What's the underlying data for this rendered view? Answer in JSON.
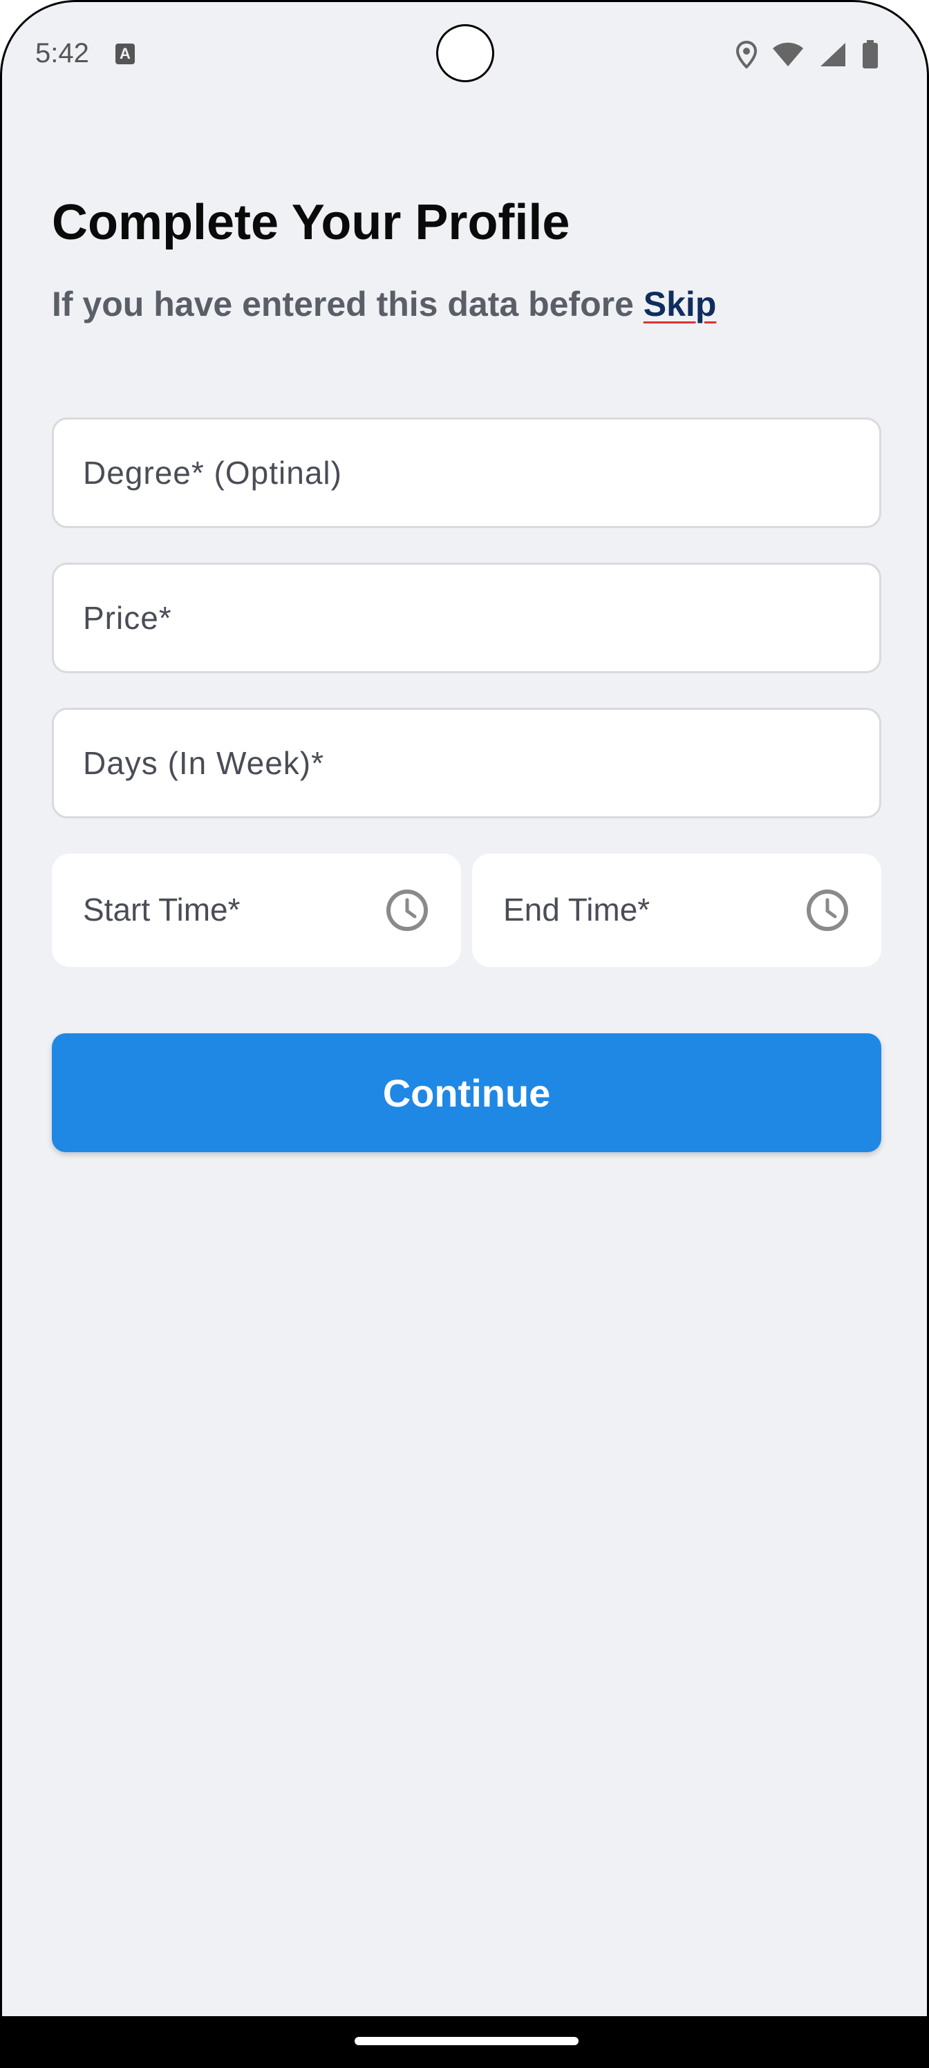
{
  "status_bar": {
    "time": "5:42",
    "keyboard_icon_letter": "A",
    "icons": [
      "location-icon",
      "wifi-icon",
      "signal-icon",
      "battery-icon"
    ]
  },
  "header": {
    "title": "Complete Your Profile",
    "subtitle_text": "If you have entered this data before ",
    "skip_label": "Skip"
  },
  "form": {
    "degree": {
      "placeholder": "Degree* (Optinal)",
      "value": ""
    },
    "price": {
      "placeholder": "Price*",
      "value": ""
    },
    "days": {
      "placeholder": "Days (In Week)*",
      "value": ""
    },
    "start_time": {
      "label": "Start Time*",
      "icon": "clock-icon"
    },
    "end_time": {
      "label": "End Time*",
      "icon": "clock-icon"
    }
  },
  "actions": {
    "continue_label": "Continue"
  },
  "colors": {
    "background": "#f0f1f5",
    "primary_button": "#1f88e5",
    "skip_link": "#0f2e5e",
    "subtitle": "#5a5e66"
  }
}
